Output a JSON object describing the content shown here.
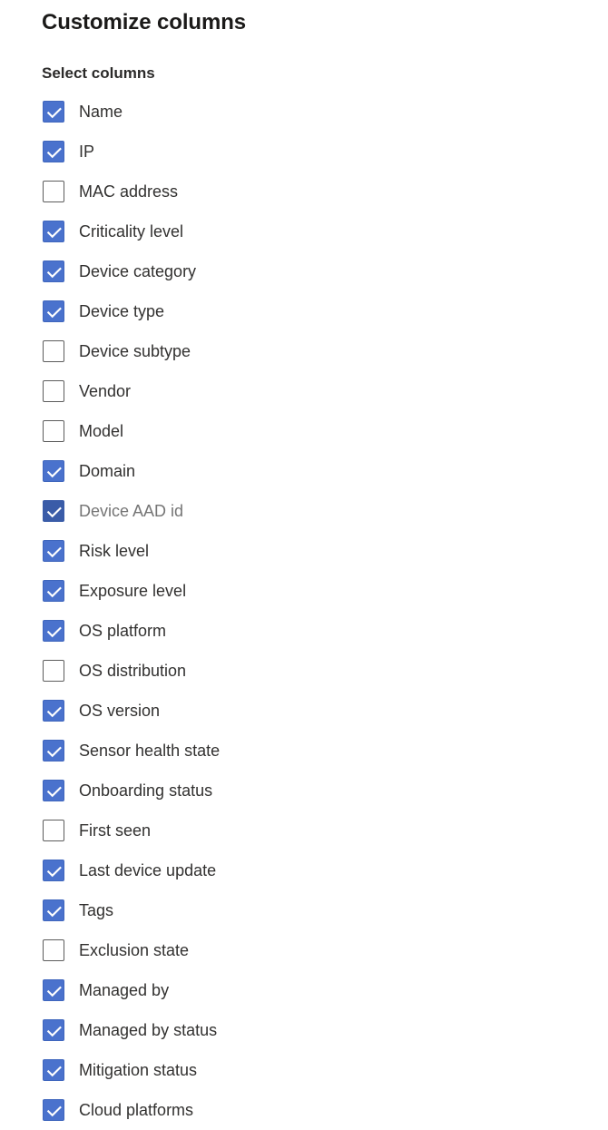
{
  "panel": {
    "title": "Customize columns",
    "group_label": "Select columns"
  },
  "colors": {
    "background": "#ffffff",
    "title_text": "#1b1a19",
    "label_text": "#323130",
    "disabled_text": "#757575",
    "checkbox_checked_fill": "#4a72cd",
    "checkbox_checked_border": "#3f66bd",
    "checkbox_disabled_fill": "#3a5ca8",
    "checkbox_unchecked_border": "#5c5c5c",
    "checkmark": "#ffffff"
  },
  "icons": {
    "checkmark": "checkmark-icon"
  },
  "columns": [
    {
      "label": "Name",
      "checked": true,
      "disabled": false
    },
    {
      "label": "IP",
      "checked": true,
      "disabled": false
    },
    {
      "label": "MAC address",
      "checked": false,
      "disabled": false
    },
    {
      "label": "Criticality level",
      "checked": true,
      "disabled": false
    },
    {
      "label": "Device category",
      "checked": true,
      "disabled": false
    },
    {
      "label": "Device type",
      "checked": true,
      "disabled": false
    },
    {
      "label": "Device subtype",
      "checked": false,
      "disabled": false
    },
    {
      "label": "Vendor",
      "checked": false,
      "disabled": false
    },
    {
      "label": "Model",
      "checked": false,
      "disabled": false
    },
    {
      "label": "Domain",
      "checked": true,
      "disabled": false
    },
    {
      "label": "Device AAD id",
      "checked": true,
      "disabled": true
    },
    {
      "label": "Risk level",
      "checked": true,
      "disabled": false
    },
    {
      "label": "Exposure level",
      "checked": true,
      "disabled": false
    },
    {
      "label": "OS platform",
      "checked": true,
      "disabled": false
    },
    {
      "label": "OS distribution",
      "checked": false,
      "disabled": false
    },
    {
      "label": "OS version",
      "checked": true,
      "disabled": false
    },
    {
      "label": "Sensor health state",
      "checked": true,
      "disabled": false
    },
    {
      "label": "Onboarding status",
      "checked": true,
      "disabled": false
    },
    {
      "label": "First seen",
      "checked": false,
      "disabled": false
    },
    {
      "label": "Last device update",
      "checked": true,
      "disabled": false
    },
    {
      "label": "Tags",
      "checked": true,
      "disabled": false
    },
    {
      "label": "Exclusion state",
      "checked": false,
      "disabled": false
    },
    {
      "label": "Managed by",
      "checked": true,
      "disabled": false
    },
    {
      "label": "Managed by status",
      "checked": true,
      "disabled": false
    },
    {
      "label": "Mitigation status",
      "checked": true,
      "disabled": false
    },
    {
      "label": "Cloud platforms",
      "checked": true,
      "disabled": false
    }
  ]
}
